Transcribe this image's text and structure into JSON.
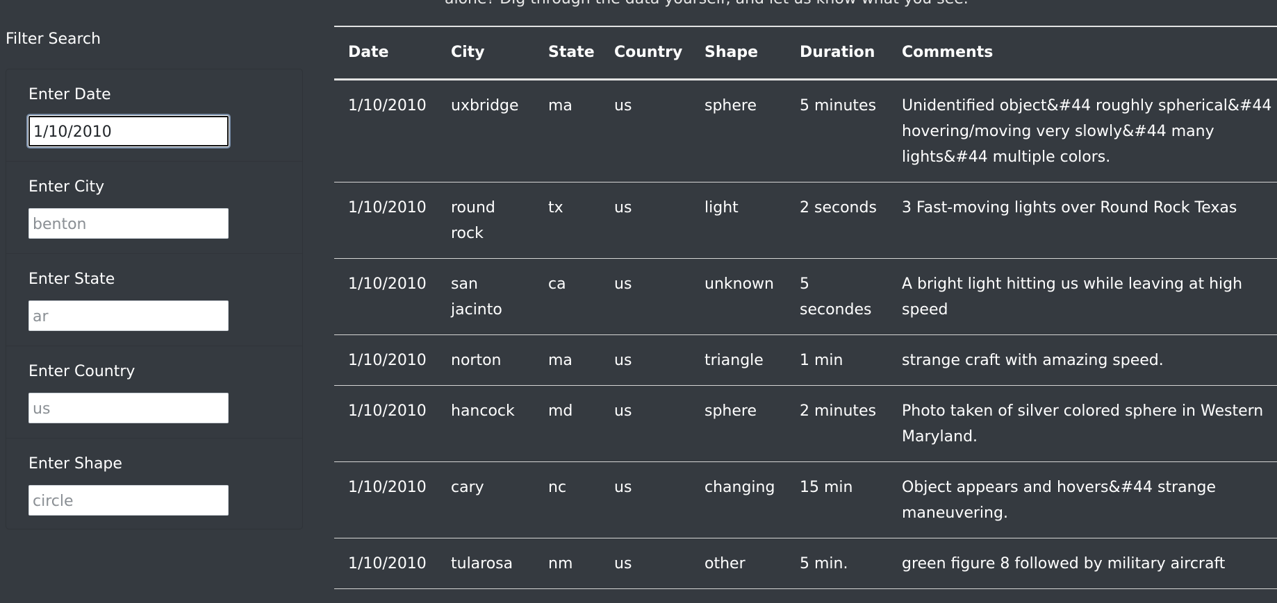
{
  "intro_text": "alone? Dig through the data yourself, and let us know what you see.",
  "sidebar": {
    "title": "Filter Search",
    "filters": [
      {
        "label": "Enter Date",
        "value": "1/10/2010",
        "placeholder": ""
      },
      {
        "label": "Enter City",
        "value": "",
        "placeholder": "benton"
      },
      {
        "label": "Enter State",
        "value": "",
        "placeholder": "ar"
      },
      {
        "label": "Enter Country",
        "value": "",
        "placeholder": "us"
      },
      {
        "label": "Enter Shape",
        "value": "",
        "placeholder": "circle"
      }
    ]
  },
  "table": {
    "headers": [
      "Date",
      "City",
      "State",
      "Country",
      "Shape",
      "Duration",
      "Comments"
    ],
    "rows": [
      [
        "1/10/2010",
        "uxbridge",
        "ma",
        "us",
        "sphere",
        "5 minutes",
        "Unidentified object&#44 roughly spherical&#44 hovering/moving very slowly&#44 many lights&#44 multiple colors."
      ],
      [
        "1/10/2010",
        "round rock",
        "tx",
        "us",
        "light",
        "2 seconds",
        "3 Fast-moving lights over Round Rock Texas"
      ],
      [
        "1/10/2010",
        "san jacinto",
        "ca",
        "us",
        "unknown",
        "5 secondes",
        "A bright light hitting us while leaving at high speed"
      ],
      [
        "1/10/2010",
        "norton",
        "ma",
        "us",
        "triangle",
        "1 min",
        "strange craft with amazing speed."
      ],
      [
        "1/10/2010",
        "hancock",
        "md",
        "us",
        "sphere",
        "2 minutes",
        "Photo taken of silver colored sphere in Western Maryland."
      ],
      [
        "1/10/2010",
        "cary",
        "nc",
        "us",
        "changing",
        "15 min",
        "Object appears and hovers&#44 strange maneuvering."
      ],
      [
        "1/10/2010",
        "tularosa",
        "nm",
        "us",
        "other",
        "5 min.",
        "green figure 8 followed by military aircraft"
      ]
    ]
  },
  "colors": {
    "background": "#353a40",
    "text": "#ffffff",
    "input_background": "#ffffff"
  }
}
